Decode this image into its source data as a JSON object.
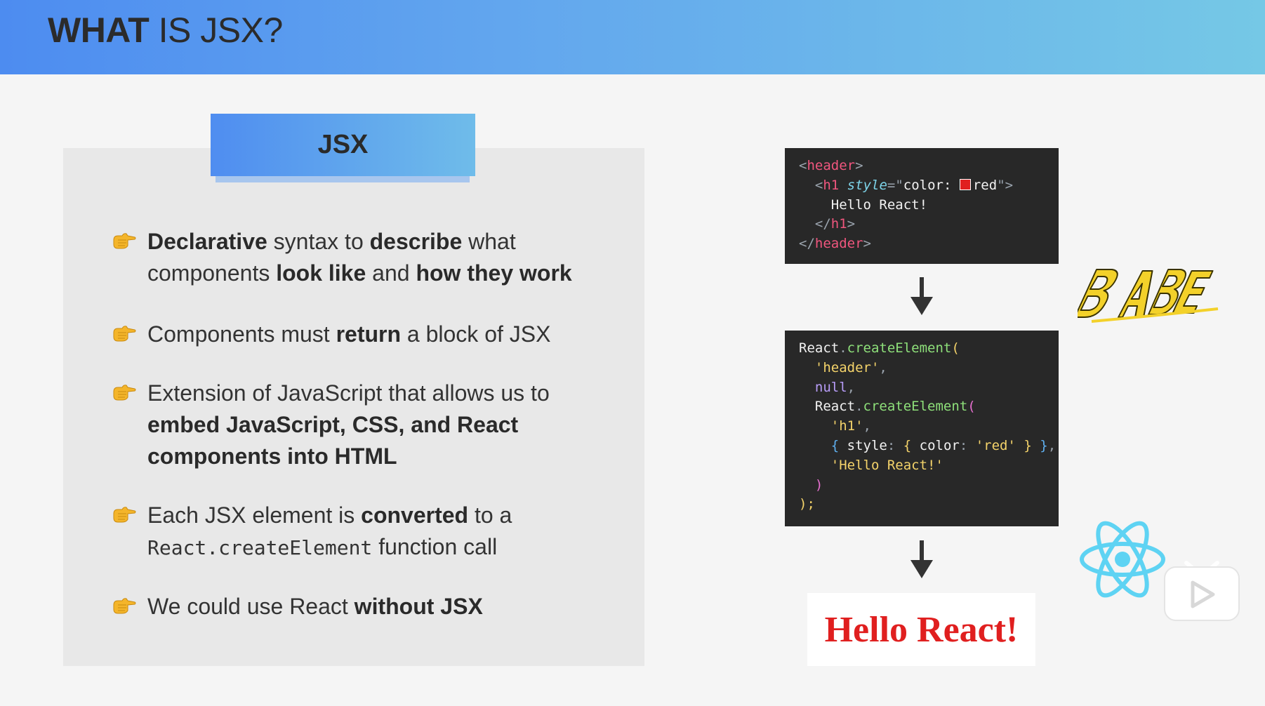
{
  "header": {
    "title_bold": "WHAT",
    "title_rest": "IS JSX?"
  },
  "panel": {
    "tag_label": "JSX"
  },
  "bullets": [
    {
      "parts": [
        {
          "t": "Declarative",
          "b": true
        },
        {
          "t": " syntax to ",
          "b": false
        },
        {
          "t": "describe",
          "b": true
        },
        {
          "t": " what components ",
          "b": false
        },
        {
          "t": "look like",
          "b": true
        },
        {
          "t": " and ",
          "b": false
        },
        {
          "t": "how they work",
          "b": true
        }
      ]
    },
    {
      "parts": [
        {
          "t": "Components must ",
          "b": false
        },
        {
          "t": "return",
          "b": true
        },
        {
          "t": " a block of JSX",
          "b": false
        }
      ]
    },
    {
      "parts": [
        {
          "t": "Extension of JavaScript that allows us to ",
          "b": false
        },
        {
          "t": "embed JavaScript, CSS, and React components into HTML",
          "b": true
        }
      ]
    },
    {
      "parts": [
        {
          "t": "Each JSX element is ",
          "b": false
        },
        {
          "t": "converted",
          "b": true
        },
        {
          "t": " to a ",
          "b": false
        },
        {
          "t": "React.createElement",
          "b": false,
          "mono": true
        },
        {
          "t": " function call",
          "b": false
        }
      ]
    },
    {
      "parts": [
        {
          "t": "We could use React ",
          "b": false
        },
        {
          "t": "without JSX",
          "b": true
        }
      ]
    }
  ],
  "code_jsx": {
    "l1_open": "<",
    "l1_tag": "header",
    "l1_close": ">",
    "l2_open": "<",
    "l2_tag": "h1",
    "l2_attr": "style",
    "l2_eq": "=\"",
    "l2_val": "color: ",
    "l2_red": "red",
    "l2_end": "\">",
    "l3_text": "Hello React!",
    "l4_open": "</",
    "l4_tag": "h1",
    "l4_close": ">",
    "l5_open": "</",
    "l5_tag": "header",
    "l5_close": ">"
  },
  "code_js": {
    "react": "React",
    "dot": ".",
    "fn": "createElement",
    "paren": "(",
    "header_str": "'header'",
    "comma": ",",
    "null": "null",
    "h1_str": "'h1'",
    "obj_open": "{ ",
    "style_key": "style",
    "colon": ": ",
    "inner_open": "{ ",
    "color_key": "color",
    "red_str": "'red'",
    "inner_close": " }",
    "obj_close": " }",
    "hello_str": "'Hello React!'",
    "close_inner": ")",
    "close_outer": ");"
  },
  "output": {
    "text": "Hello React!"
  },
  "colors": {
    "accent_blue": "#4d8cf0",
    "accent_cyan": "#75c8e6",
    "output_red": "#e01f1f",
    "code_bg": "#282828"
  },
  "icons": {
    "bullet_icon": "pointing-hand-icon",
    "arrow_icon": "arrow-down-icon",
    "babel_logo": "babel-logo",
    "react_logo": "react-logo-icon",
    "play_button": "play-button-icon"
  }
}
